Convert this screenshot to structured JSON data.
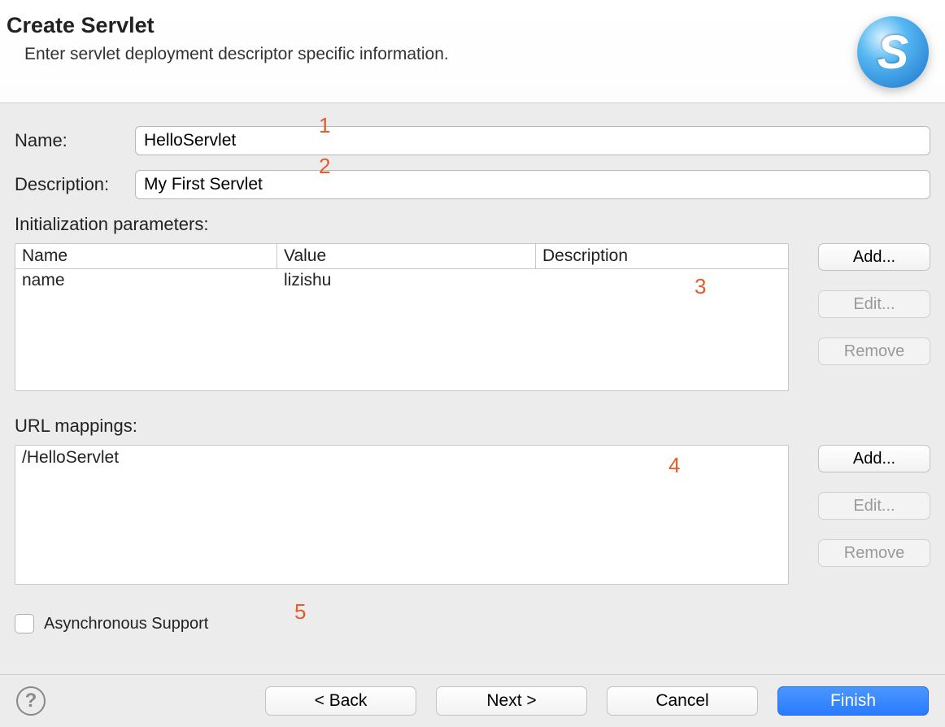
{
  "header": {
    "title": "Create Servlet",
    "subtitle": "Enter servlet deployment descriptor specific information.",
    "iconLetter": "S"
  },
  "fields": {
    "nameLabel": "Name:",
    "nameValue": "HelloServlet",
    "descLabel": "Description:",
    "descValue": "My First Servlet"
  },
  "initParams": {
    "label": "Initialization parameters:",
    "columns": {
      "name": "Name",
      "value": "Value",
      "desc": "Description"
    },
    "rows": [
      {
        "name": "name",
        "value": "lizishu",
        "desc": ""
      }
    ],
    "buttons": {
      "add": "Add...",
      "edit": "Edit...",
      "remove": "Remove"
    }
  },
  "urlMappings": {
    "label": "URL mappings:",
    "items": [
      "/HelloServlet"
    ],
    "buttons": {
      "add": "Add...",
      "edit": "Edit...",
      "remove": "Remove"
    }
  },
  "asyncLabel": "Asynchronous Support",
  "footer": {
    "back": "< Back",
    "next": "Next >",
    "cancel": "Cancel",
    "finish": "Finish"
  },
  "annotations": {
    "a1": "1",
    "a2": "2",
    "a3": "3",
    "a4": "4",
    "a5": "5"
  }
}
